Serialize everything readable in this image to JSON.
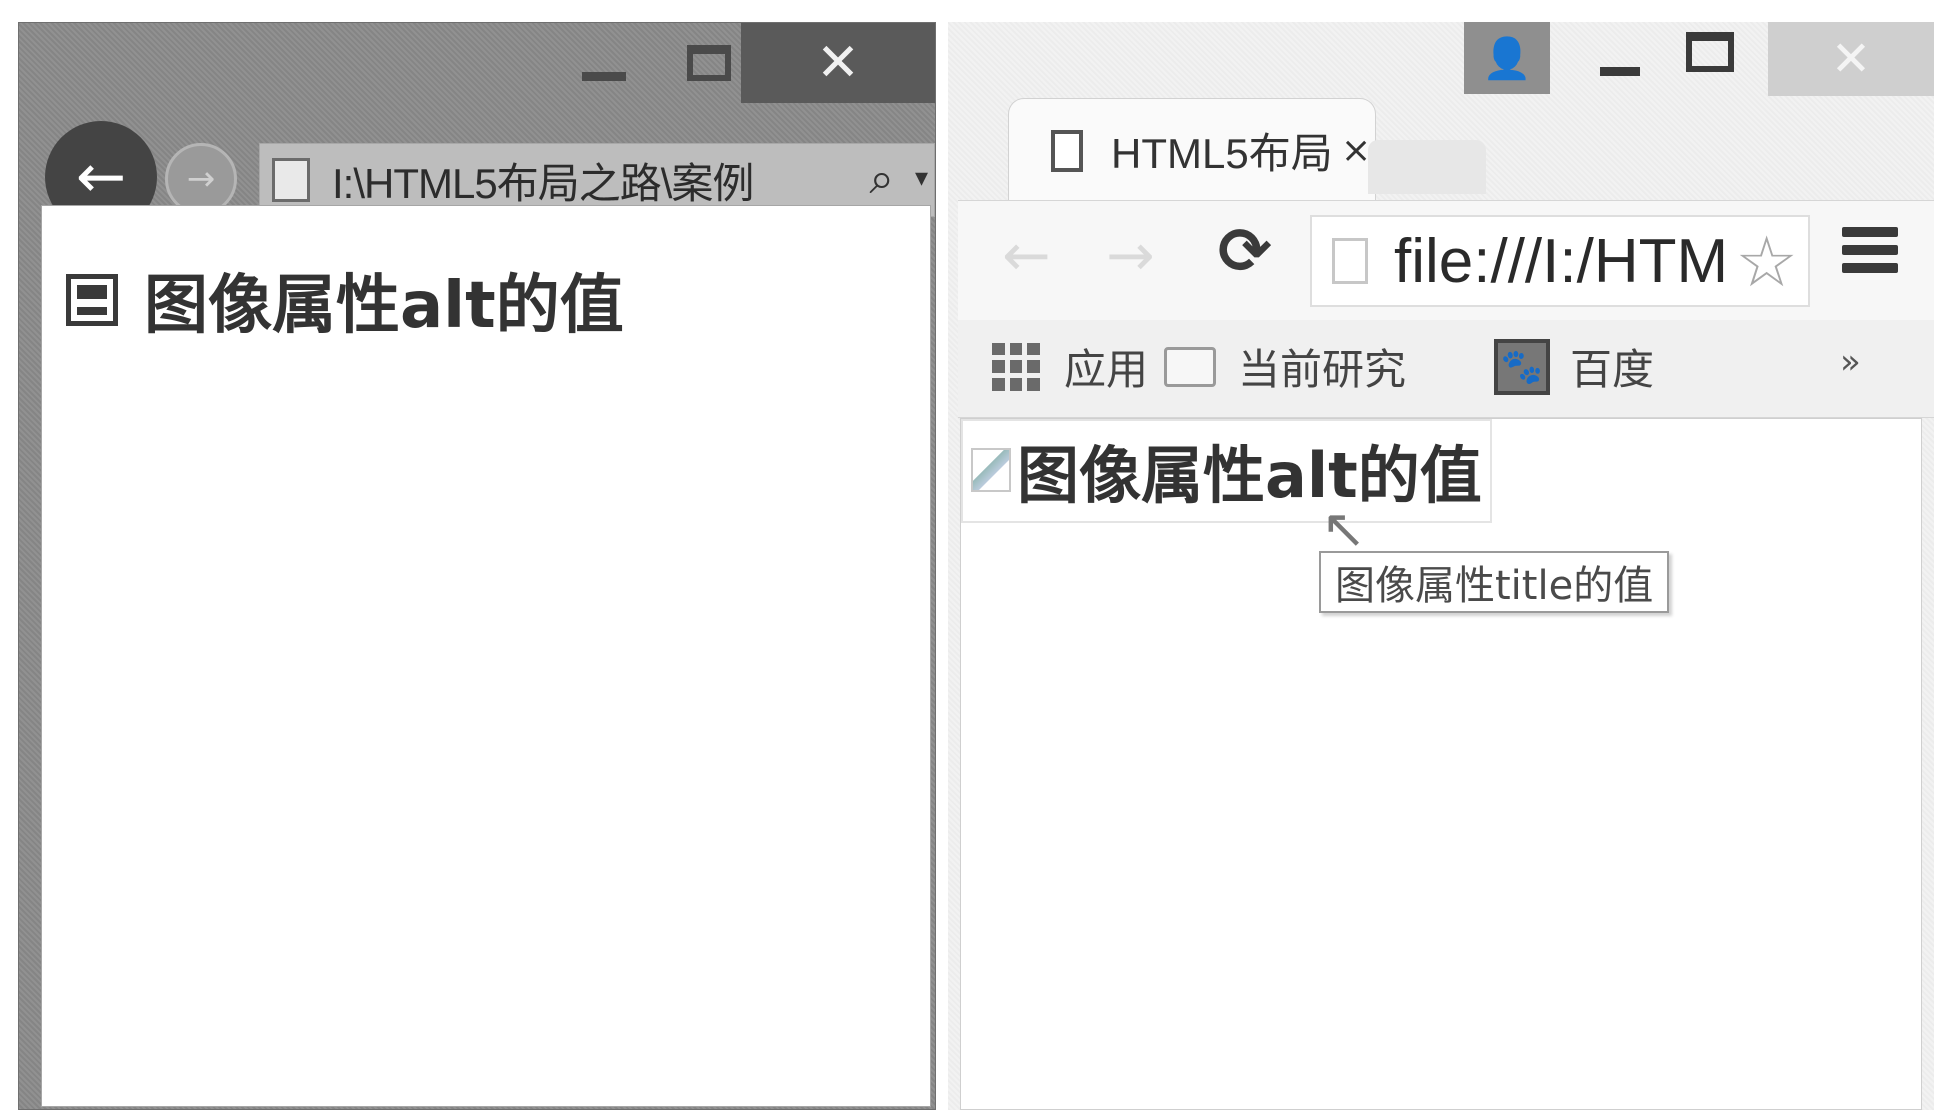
{
  "left_window": {
    "title_buttons": {
      "minimize": "—",
      "maximize": "☐",
      "close": "✕"
    },
    "nav": {
      "back": "←",
      "forward": "→"
    },
    "address": {
      "url": "I:\\HTML5布局之路\\案例",
      "search_icon": "⌕",
      "dropdown": "▾"
    },
    "content": {
      "alt_text": "图像属性alt的值"
    }
  },
  "right_window": {
    "title_buttons": {
      "user": "👤",
      "close": "✕"
    },
    "tab": {
      "title": "HTML5布局",
      "close": "×"
    },
    "toolbar": {
      "back": "←",
      "forward": "→",
      "reload": "⟳",
      "url": "file:///I:/HTML",
      "star": "☆"
    },
    "bookmarks": {
      "apps": "应用",
      "folder": "当前研究",
      "baidu": "百度",
      "baidu_icon": "🐾",
      "more": "»"
    },
    "content": {
      "alt_text": "图像属性alt的值",
      "cursor": "↖",
      "tooltip": "图像属性title的值"
    }
  }
}
